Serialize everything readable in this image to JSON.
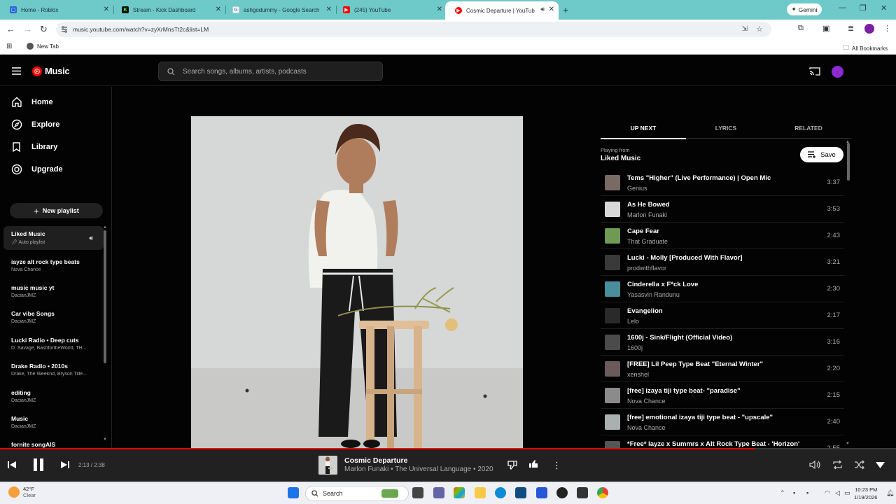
{
  "browser": {
    "tabs": [
      {
        "title": "Home - Roblox",
        "favicon": "roblox"
      },
      {
        "title": "Stream - Kick Dashboard",
        "favicon": "kick"
      },
      {
        "title": "ashgodummy - Google Search",
        "favicon": "google"
      },
      {
        "title": "(245) YouTube",
        "favicon": "youtube"
      },
      {
        "title": "Cosmic Departure | YouTub",
        "favicon": "ytmusic"
      }
    ],
    "gemini_label": "Gemini",
    "url": "music.youtube.com/watch?v=zyXrMnsTt2c&list=LM",
    "bookmark_new_tab": "New Tab",
    "all_bookmarks": "All Bookmarks"
  },
  "ytm": {
    "logo_text": "Music",
    "search_placeholder": "Search songs, albums, artists, podcasts",
    "nav": [
      {
        "label": "Home",
        "icon": "home-icon"
      },
      {
        "label": "Explore",
        "icon": "explore-icon"
      },
      {
        "label": "Library",
        "icon": "library-icon"
      },
      {
        "label": "Upgrade",
        "icon": "upgrade-icon"
      }
    ],
    "new_playlist_label": "New playlist",
    "playlists": [
      {
        "title": "Liked Music",
        "subtitle": "Auto playlist"
      },
      {
        "title": "iayze alt rock type beats",
        "subtitle": "Nova Chance"
      },
      {
        "title": "music music yt",
        "subtitle": "DacianJMZ"
      },
      {
        "title": "Car vibe Songs",
        "subtitle": "DacianJMZ"
      },
      {
        "title": "Lucki Radio • Deep cuts",
        "subtitle": "D. Savage, BashfortheWorld, TH..."
      },
      {
        "title": "Drake Radio • 2010s",
        "subtitle": "Drake, The Weeknd, Bryson Tille..."
      },
      {
        "title": "editing",
        "subtitle": "DacianJMZ"
      },
      {
        "title": "Music",
        "subtitle": "DacianJMZ"
      },
      {
        "title": "fornite songAIS",
        "subtitle": ""
      }
    ],
    "right_panel": {
      "tabs": [
        "UP NEXT",
        "LYRICS",
        "RELATED"
      ],
      "playing_from_label": "Playing from",
      "playing_from": "Liked Music",
      "save_label": "Save",
      "queue": [
        {
          "title": "Tems \"Higher\" (Live Performance) | Open Mic",
          "artist": "Genius",
          "duration": "3:37",
          "thumb": "#7a6a64"
        },
        {
          "title": "As He Bowed",
          "artist": "Marlon Funaki",
          "duration": "3:53",
          "thumb": "#d8d8d8"
        },
        {
          "title": "Cape Fear",
          "artist": "That Graduate",
          "duration": "2:43",
          "thumb": "#6f9a54"
        },
        {
          "title": "Lucki - Molly [Produced With Flavor]",
          "artist": "prodwithflavor",
          "duration": "3:21",
          "thumb": "#3a3a3a"
        },
        {
          "title": "Cinderella x F*ck Love",
          "artist": "Yasasvin Randunu",
          "duration": "2:30",
          "thumb": "#4a8d9c"
        },
        {
          "title": "Evangelion",
          "artist": "Lelo",
          "duration": "2:17",
          "thumb": "#2a2a2a"
        },
        {
          "title": "1600j - Sink/Flight (Official Video)",
          "artist": "1600j",
          "duration": "3:16",
          "thumb": "#4b4b4b"
        },
        {
          "title": "[FREE] Lil Peep Type Beat \"Eternal Winter\"",
          "artist": "xenshel",
          "duration": "2:20",
          "thumb": "#6a5a5a"
        },
        {
          "title": "[free] izaya tiji type beat- \"paradise\"",
          "artist": "Nova Chance",
          "duration": "2:15",
          "thumb": "#8b8b8b"
        },
        {
          "title": "[free] emotional izaya tiji type beat - \"upscale\"",
          "artist": "Nova Chance",
          "duration": "2:40",
          "thumb": "#a8b0b0"
        },
        {
          "title": "*Free* Iayze x Summrs x Alt Rock Type Beat - 'Horizon'",
          "artist": "",
          "duration": "2:55",
          "thumb": "#555555"
        }
      ]
    },
    "player": {
      "time": "2:13 / 2:38",
      "progress": 0.842,
      "title": "Cosmic Departure",
      "subtitle": "Marlon Funaki • The Universal Language • 2020"
    }
  },
  "taskbar": {
    "temperature": "42°F",
    "condition": "Clear",
    "search_label": "Search",
    "time": "10:23 PM",
    "date": "1/19/2026"
  },
  "colors": {
    "tabbar": "#6ec9c9",
    "ytm_bg": "#030303",
    "accent_red": "#ff0000",
    "player_bg": "#212121"
  }
}
